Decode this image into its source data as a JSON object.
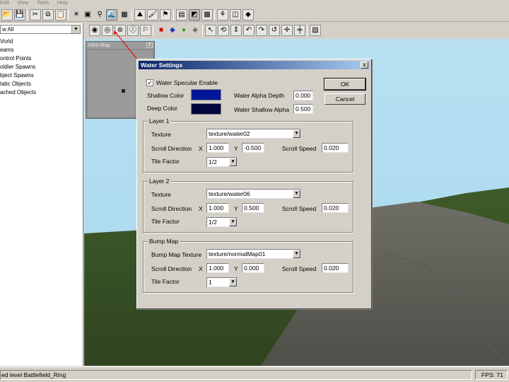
{
  "menu": [
    "Edit",
    "View",
    "Tools",
    "Help"
  ],
  "toolbar1_icons": [
    "open-icon",
    "save-icon",
    "cut-icon",
    "copy-icon",
    "paste-icon",
    "light-icon",
    "window-icon",
    "tree-icon",
    "water-icon",
    "grid-icon",
    "terrain-icon",
    "paint-icon",
    "stamp-icon",
    "grid-view-icon",
    "texture-icon",
    "green-grid-icon",
    "group-icon",
    "split-icon",
    "object-icon"
  ],
  "toolbar2_icons": [
    "globe-icon",
    "globe2-icon",
    "target-icon",
    "info-icon",
    "flag-icon",
    "cube-red-icon",
    "cube-blue-icon",
    "sphere-green-icon",
    "cube-pink-icon",
    "select-arrow-icon",
    "rotate-icon",
    "scale-icon",
    "undo-icon",
    "redo-icon",
    "rotate-left-icon",
    "move-icon",
    "snap-icon",
    "image-icon"
  ],
  "sidebar": {
    "filter_value": "w All",
    "items": [
      "Vorld",
      "eams",
      "ontrol Points",
      "oldier Spawns",
      "bject Spawns",
      "tatic Objects",
      "ached Objects"
    ]
  },
  "minimap": {
    "title": "Mini-Map",
    "close": "x"
  },
  "dialog": {
    "title": "Water Settings",
    "close_label": "x",
    "specular_label": "Water Specular Enable",
    "specular_checked": true,
    "shallow_color_label": "Shallow Color",
    "deep_color_label": "Deep Color",
    "shallow_color": "#00179a",
    "deep_color": "#00073c",
    "alpha_depth_label": "Water Alpha Depth",
    "alpha_depth_value": "0.000",
    "shallow_alpha_label": "Water Shallow Alpha",
    "shallow_alpha_value": "0.500",
    "ok_label": "OK",
    "cancel_label": "Cancel",
    "layer1": {
      "title": "Layer 1",
      "texture_label": "Texture",
      "texture_value": "texture/water02",
      "scroll_label": "Scroll Direction",
      "x_label": "X",
      "x_value": "1.000",
      "y_label": "Y",
      "y_value": "-0.500",
      "speed_label": "Scroll Speed",
      "speed_value": "0.020",
      "tile_label": "Tile Factor",
      "tile_value": "1/2"
    },
    "layer2": {
      "title": "Layer 2",
      "texture_label": "Texture",
      "texture_value": "texture/water06",
      "scroll_label": "Scroll Direction",
      "x_label": "X",
      "x_value": "1.000",
      "y_label": "Y",
      "y_value": "0.500",
      "speed_label": "Scroll Speed",
      "speed_value": "0.020",
      "tile_label": "Tile Factor",
      "tile_value": "1/2"
    },
    "bump": {
      "title": "Bump Map",
      "texture_label": "Bump Map Texture",
      "texture_value": "texture/normalMap01",
      "scroll_label": "Scroll Direction",
      "x_label": "X",
      "x_value": "1.000",
      "y_label": "Y",
      "y_value": "0.000",
      "speed_label": "Scroll Speed",
      "speed_value": "0.020",
      "tile_label": "Tile Factor",
      "tile_value": "1"
    }
  },
  "status": {
    "message": "ed level Battlefield_Ring",
    "fps": "FPS: 71"
  }
}
